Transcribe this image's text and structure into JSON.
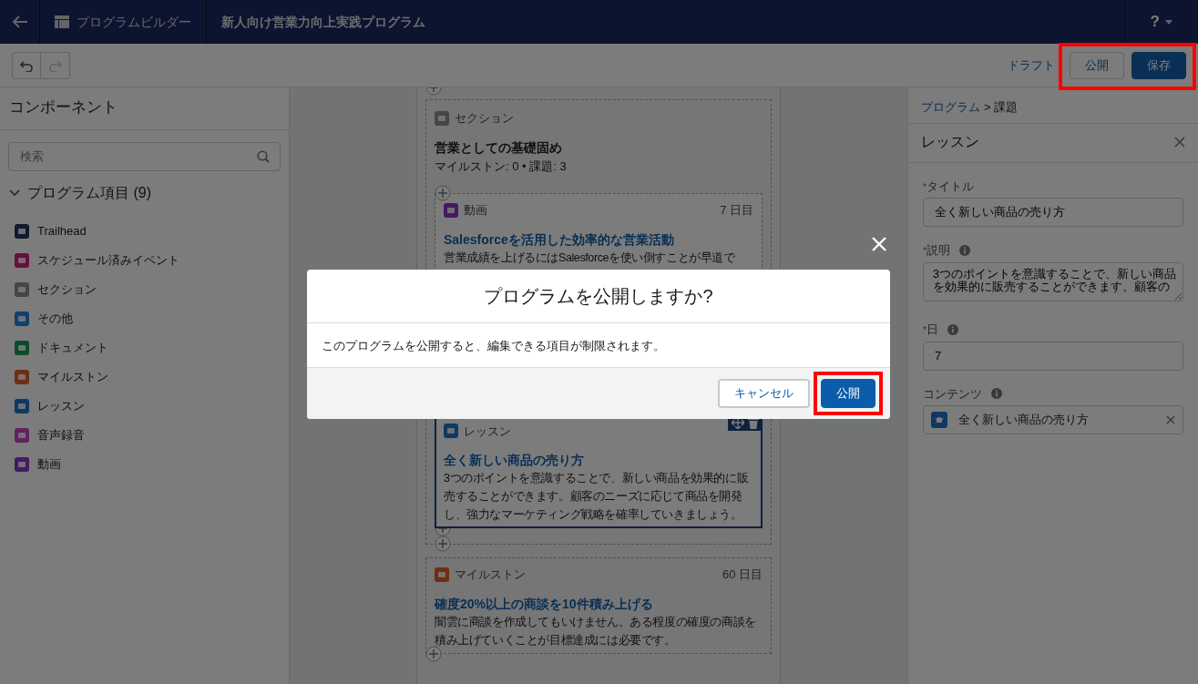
{
  "header": {
    "app_name": "プログラムビルダー",
    "title": "新人向け営業力向上実践プログラム",
    "help": "?"
  },
  "toolbar": {
    "undo_disabled": false,
    "redo_disabled": true,
    "status": "ドラフト",
    "actions_highlighted": true,
    "actions": [
      {
        "label": "公開",
        "kind": "outline"
      },
      {
        "label": "保存",
        "kind": "brand"
      }
    ]
  },
  "sidebar": {
    "title": "コンポーネント",
    "search": {
      "placeholder": "検索"
    },
    "group": {
      "label": "プログラム項目 (9)",
      "expanded": true,
      "items": [
        {
          "label": "Trailhead",
          "kind": "trailhead"
        },
        {
          "label": "スケジュール済みイベント",
          "kind": "event"
        },
        {
          "label": "セクション",
          "kind": "section"
        },
        {
          "label": "その他",
          "kind": "other"
        },
        {
          "label": "ドキュメント",
          "kind": "document"
        },
        {
          "label": "マイルストン",
          "kind": "milestone"
        },
        {
          "label": "レッスン",
          "kind": "lesson"
        },
        {
          "label": "音声録音",
          "kind": "audio"
        },
        {
          "label": "動画",
          "kind": "video"
        }
      ]
    }
  },
  "canvas": {
    "section": {
      "type_label": "セクション",
      "title": "営業としての基礎固め",
      "meta": "マイルストン: 0 • 課題: 3",
      "items": [
        {
          "kind": "video",
          "type_label": "動画",
          "day": "7 日目",
          "title": "Salesforceを活用した効率的な営業活動",
          "description": "営業成績を上げるにはSalesforceを使い倒すことが早道で",
          "selected": false
        },
        {
          "kind": "lesson",
          "type_label": "レッスン",
          "title": "全く新しい商品の売り方",
          "description": "3つのポイントを意識することで、新しい商品を効果的に販売することができます。顧客のニーズに応じて商品を開発し、強力なマーケティング戦略を確率していきましょう。",
          "selected": true
        }
      ]
    },
    "after": [
      {
        "kind": "milestone",
        "type_label": "マイルストン",
        "day": "60 日目",
        "title": "確度20%以上の商談を10件積み上げる",
        "description": "闇雲に商談を作成してもいけません。ある程度の確度の商談を積み上げていくことが目標達成には必要です。",
        "selected": false
      }
    ]
  },
  "panel": {
    "breadcrumb": [
      {
        "label": "プログラム",
        "link": true
      },
      {
        "label": "> 課題",
        "link": false
      }
    ],
    "heading": "レッスン",
    "fields": [
      {
        "kind": "input",
        "label": "タイトル",
        "required_mark": "*",
        "info": false,
        "value": "全く新しい商品の売り方"
      },
      {
        "kind": "textarea",
        "label": "説明",
        "required_mark": "*",
        "info": true,
        "value": "3つのポイントを意識することで、新しい商品を効果的に販売することができます。顧客の"
      },
      {
        "kind": "input",
        "label": "日",
        "required_mark": "*",
        "info": true,
        "value": "7"
      },
      {
        "kind": "lookup",
        "label": "コンテンツ",
        "info": true,
        "value": "全く新しい商品の売り方"
      }
    ]
  },
  "modal": {
    "title": "プログラムを公開しますか?",
    "message": "このプログラムを公開すると、編集できる項目が制限されます。",
    "buttons": [
      {
        "label": "キャンセル",
        "kind": "neutral"
      },
      {
        "label": "公開",
        "kind": "brand",
        "highlighted": true
      }
    ]
  }
}
